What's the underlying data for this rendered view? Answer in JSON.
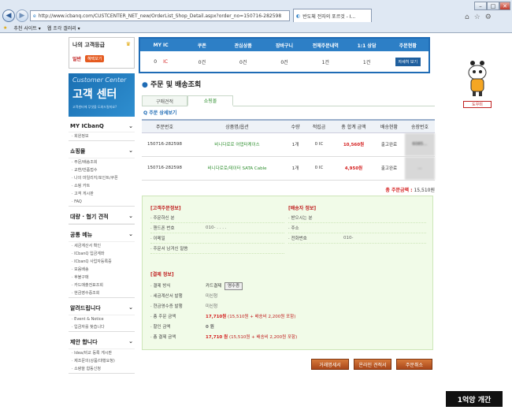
{
  "browser": {
    "url": "http://www.icbanq.com/CUSTCENTER_NET_new/OrderList_Shop_Detail.aspx?order_no=150716-282598",
    "tab_title": "반도체 전자의 포르것 - I...",
    "fav_recommended": "추천 사이트 ▾",
    "fav_gallery": "웹 조각 갤러리 ▾"
  },
  "sidebar": {
    "my_title": "나의 고객등급",
    "grade": "일반",
    "grade_btn": "혜택보기",
    "cc_en": "Customer Center",
    "cc_ko": "고객 센터",
    "cc_sub": "고객센터에 무엇을 도와드릴까요?",
    "sections": [
      {
        "title": "MY ICbanQ",
        "items": [
          "· 회원정보"
        ]
      },
      {
        "title": "쇼핑몰",
        "items": [
          "· 주문/배송조회",
          "· 교환/반품접수",
          "· 나의 마일리지/포인트/쿠폰",
          "· 쇼핑 카트",
          "· 고객 게시판",
          "· FAQ"
        ]
      },
      {
        "title": "대량 · 협기 견적",
        "items": []
      },
      {
        "title": "공통 메뉴",
        "items": [
          "· 세금계산서 확인",
          "· ICbanQ 입금계좌",
          "· ICbanQ 사업자등록증",
          "· 모음배송",
          "· 후불구매",
          "· 카드매출전표조회",
          "· 현금영수증조회"
        ]
      },
      {
        "title": "알려드립니다",
        "items": [
          "· Event & Notice",
          "· 입금자를 찾습니다"
        ]
      },
      {
        "title": "제안 합니다",
        "items": [
          "· Idea/비교 등록 게시판",
          "· 제조문의(상품/대행요청)",
          "· 소량을 합동신청"
        ]
      }
    ]
  },
  "stats": {
    "headers": [
      "MY IC",
      "쿠폰",
      "관심상품",
      "장바구니",
      "전체주문내역",
      "1:1 상담",
      "주문현황"
    ],
    "values": [
      "0",
      "0건",
      "0건",
      "0건",
      "1건",
      "1건"
    ],
    "ic_label": "IC",
    "detail_btn": "자세히 보기"
  },
  "main": {
    "title": "주문 및 배송조회",
    "tab_purchase": "구매견적",
    "tab_shop": "쇼핑몰",
    "subtitle": "주문 상세보기",
    "columns": [
      "주문번호",
      "상품명/옵션",
      "수량",
      "적립금",
      "총 합계 금액",
      "배송현황",
      "송장번호"
    ],
    "rows": [
      {
        "order_no": "150716-282598",
        "product": "비니다로로 어댑터케이스",
        "qty": "1개",
        "points": "0 IC",
        "amount": "10,560원",
        "status": "출고완료",
        "tracking": "6085..."
      },
      {
        "order_no": "150716-282598",
        "product": "비니다로로/데이터 SATA Cable",
        "qty": "1개",
        "points": "0 IC",
        "amount": "4,950원",
        "status": "출고완료",
        "tracking": "..."
      }
    ],
    "total_label": "총 주문금액 :",
    "total_value": "15,510원"
  },
  "orderer": {
    "title": "[고객주문정보]",
    "fields": [
      {
        "label": "· 주문하신 분",
        "value": ""
      },
      {
        "label": "· 핸드폰 번호",
        "value": "010- . . . ."
      },
      {
        "label": "· 이메일",
        "value": ""
      },
      {
        "label": "· 주문서 남겨신 말씀",
        "value": ""
      }
    ]
  },
  "shipping": {
    "title": "[배송자 정보]",
    "fields": [
      {
        "label": "· 받으시는 분",
        "value": ""
      },
      {
        "label": "· 주소",
        "value": ""
      },
      {
        "label": "· 전화번호",
        "value": "010-"
      }
    ]
  },
  "payment": {
    "title": "[결제 정보]",
    "method_label": "· 결제 방식",
    "method_value": "카드결제",
    "receipt_btn": "영수증",
    "tax_label": "· 세금계산서 발행",
    "tax_value": "미신청",
    "cash_label": "· 현금영수증 발행",
    "cash_value": "미신청",
    "order_amt_label": "· 총 주문 금액",
    "order_amt_value": "17,710원",
    "order_amt_note": "(15,510원 + 배송비 2,200원 포함)",
    "discount_label": "· 할인 금액",
    "discount_value": "0 원",
    "pay_amt_label": "· 총 결제 금액",
    "pay_amt_value": "17,710 원",
    "pay_amt_note": "(15,510원 + 배송비 2,200원 포함)"
  },
  "buttons": {
    "tax_invoice": "거래명세서",
    "quote": "온라인 견적서",
    "cancel": "주문취소"
  },
  "mascot_label": "도우미",
  "watermark": "1억앙 개간",
  "colors": {
    "brand_blue": "#1f6cb5",
    "accent_red": "#d41e1e",
    "green": "#2f8f2f",
    "panel_green": "#f1fbe8"
  }
}
